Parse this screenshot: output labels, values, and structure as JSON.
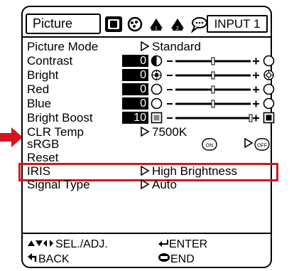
{
  "header": {
    "active_tab": "Picture",
    "tab_icons": [
      "monitor-icon",
      "settings-icon",
      "setup-icon-1",
      "setup-icon-2",
      "speech-bubble-icon"
    ],
    "input": "INPUT 1"
  },
  "menu": {
    "picture_mode": {
      "label": "Picture Mode",
      "value": "Standard"
    },
    "contrast": {
      "label": "Contrast",
      "value": "0",
      "level": 0.5
    },
    "bright": {
      "label": "Bright",
      "value": "0",
      "level": 0.5
    },
    "red": {
      "label": "Red",
      "value": "0",
      "level": 0.5
    },
    "blue": {
      "label": "Blue",
      "value": "0",
      "level": 0.5
    },
    "bright_boost": {
      "label": "Bright Boost",
      "value": "10",
      "level": 1.0
    },
    "clr_temp": {
      "label": "CLR Temp",
      "value": "7500K"
    },
    "srgb": {
      "label": "sRGB",
      "left_badge": "ON",
      "right_badge": "OFF"
    },
    "reset": {
      "label": "Reset"
    },
    "iris": {
      "label": "IRIS",
      "value": "High Brightness"
    },
    "signal_type": {
      "label": "Signal Type",
      "value": "Auto"
    }
  },
  "footer": {
    "sel_adj": "SEL./ADJ.",
    "enter": "ENTER",
    "back": "BACK",
    "end": "END"
  },
  "colors": {
    "highlight": "#d6141e"
  }
}
